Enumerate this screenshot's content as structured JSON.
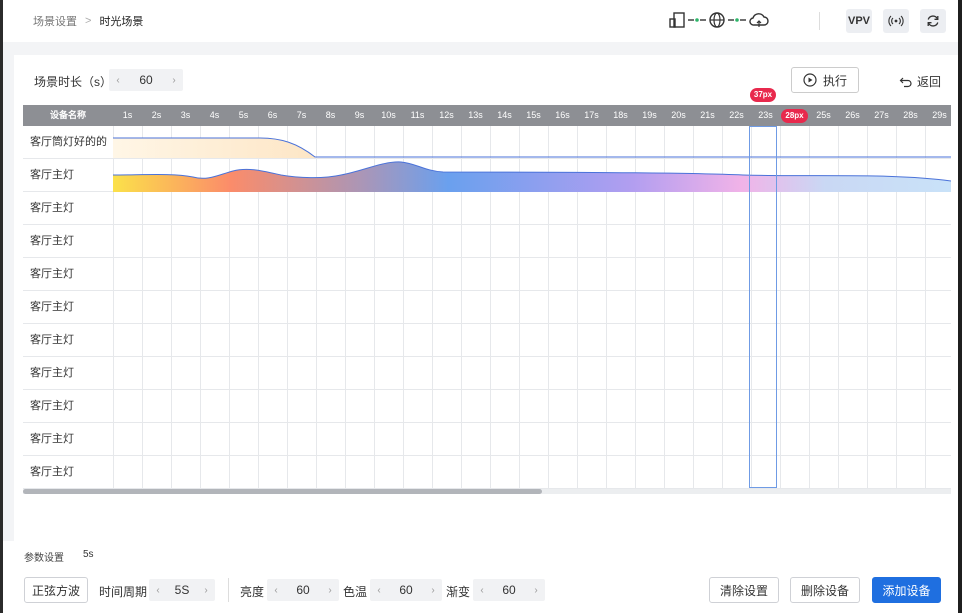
{
  "breadcrumb": {
    "root": "场景设置",
    "separator": ">",
    "current": "时光场景"
  },
  "header_buttons": {
    "vpv": "VPV",
    "signal_icon": "broadcast-icon",
    "refresh_icon": "refresh-icon"
  },
  "network_icons": [
    "device-icon",
    "globe-icon",
    "cloud-icon"
  ],
  "scene": {
    "duration_label": "场景时长（s）",
    "duration_value": "60",
    "execute_label": "执行",
    "back_label": "返回"
  },
  "timeline": {
    "name_header": "设备名称",
    "time_columns": [
      "1s",
      "2s",
      "3s",
      "4s",
      "5s",
      "6s",
      "7s",
      "8s",
      "9s",
      "10s",
      "11s",
      "12s",
      "13s",
      "14s",
      "15s",
      "16s",
      "17s",
      "18s",
      "19s",
      "20s",
      "21s",
      "22s",
      "23s",
      "28px",
      "25s",
      "26s",
      "27s",
      "28s",
      "29s"
    ],
    "highlight_badge": "37px",
    "devices": [
      "客厅筒灯好的的",
      "客厅主灯",
      "客厅主灯",
      "客厅主灯",
      "客厅主灯",
      "客厅主灯",
      "客厅主灯",
      "客厅主灯",
      "客厅主灯",
      "客厅主灯",
      "客厅主灯"
    ],
    "colors": {
      "header_bg": "#8d8f94",
      "badge": "#e8294d",
      "highlight": "#6f9be5",
      "curve_line": "#4a72d9"
    }
  },
  "params": {
    "label": "参数设置",
    "value": "5s",
    "waveform": "正弦方波",
    "period_label": "时间周期",
    "period_value": "5S",
    "brightness_label": "亮度",
    "brightness_value": "60",
    "color_temp_label": "色温",
    "color_temp_value": "60",
    "fade_label": "渐变",
    "fade_value": "60",
    "clear_button": "清除设置",
    "delete_button": "删除设备",
    "add_button": "添加设备"
  },
  "accent_color": "#1f6fe0"
}
